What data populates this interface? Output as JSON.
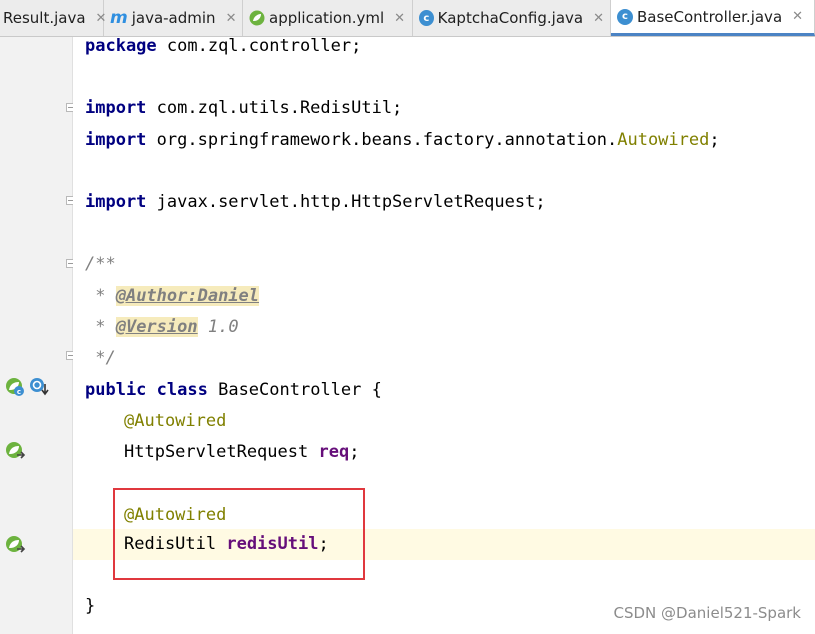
{
  "tabs": [
    {
      "label": "Result.java",
      "icon": "class-icon",
      "active": false
    },
    {
      "label": "java-admin",
      "icon": "maven-icon",
      "active": false
    },
    {
      "label": "application.yml",
      "icon": "spring-leaf-icon",
      "active": false
    },
    {
      "label": "KaptchaConfig.java",
      "icon": "class-icon",
      "active": false
    },
    {
      "label": "BaseController.java",
      "icon": "class-icon",
      "active": true
    }
  ],
  "tab_close_glyph": "✕",
  "class_icon_letter": "c",
  "maven_icon_letter": "m",
  "code": {
    "package_kw": "package",
    "package_name": " com.zql.controller;",
    "import_kw": "import",
    "import1": " com.zql.utils.RedisUtil;",
    "import2_pre": " org.springframework.beans.factory.annotation.",
    "import2_cls": "Autowired",
    "import2_post": ";",
    "import3": " javax.servlet.http.HttpServletRequest;",
    "doc_open": "/**",
    "doc_star": " * ",
    "author_tag": "@Author:Daniel",
    "version_tag": "@Version",
    "version_val": " 1.0",
    "doc_close": " */",
    "public_kw": "public",
    "class_kw": "class",
    "class_decl": " BaseController {",
    "autowired": "@Autowired",
    "field1_type": "HttpServletRequest ",
    "field1_name": "req",
    "semicolon": ";",
    "field2_type": "RedisUtil ",
    "field2_name": "redisUtil",
    "close_brace": "}"
  },
  "watermark": "CSDN @Daniel521-Spark",
  "colors": {
    "keyword": "#000080",
    "annotation": "#808000",
    "field": "#660e7a",
    "comment": "#808080",
    "highlight_box": "#e0383e",
    "current_line": "#fffae3"
  }
}
